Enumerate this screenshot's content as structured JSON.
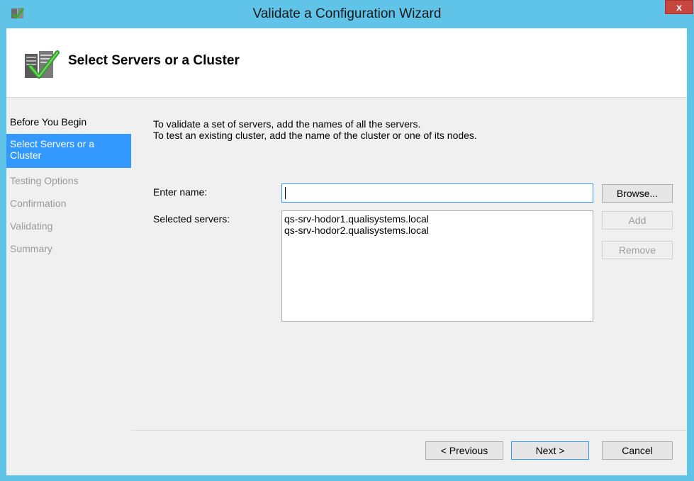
{
  "window": {
    "title": "Validate a Configuration Wizard",
    "close_glyph": "x"
  },
  "header": {
    "title": "Select Servers or a Cluster",
    "icon": "server-check-icon"
  },
  "nav": {
    "items": [
      {
        "label": "Before You Begin",
        "state": "done"
      },
      {
        "label": "Select Servers or a Cluster",
        "state": "active"
      },
      {
        "label": "Testing Options",
        "state": "pending"
      },
      {
        "label": "Confirmation",
        "state": "pending"
      },
      {
        "label": "Validating",
        "state": "pending"
      },
      {
        "label": "Summary",
        "state": "pending"
      }
    ]
  },
  "main": {
    "intro_line1": "To validate a set of servers, add the names of all the servers.",
    "intro_line2": "To test an existing cluster, add the name of the cluster or one of its nodes.",
    "enter_name_label": "Enter name:",
    "enter_name_value": "",
    "selected_servers_label": "Selected servers:",
    "selected_servers": [
      "qs-srv-hodor1.qualisystems.local",
      "qs-srv-hodor2.qualisystems.local"
    ],
    "browse_label": "Browse...",
    "add_label": "Add",
    "remove_label": "Remove"
  },
  "footer": {
    "previous_label": "< Previous",
    "next_label": "Next >",
    "cancel_label": "Cancel"
  },
  "colors": {
    "titlebar": "#5fc4e8",
    "nav_active": "#3399ff",
    "close_button": "#c7463f"
  }
}
